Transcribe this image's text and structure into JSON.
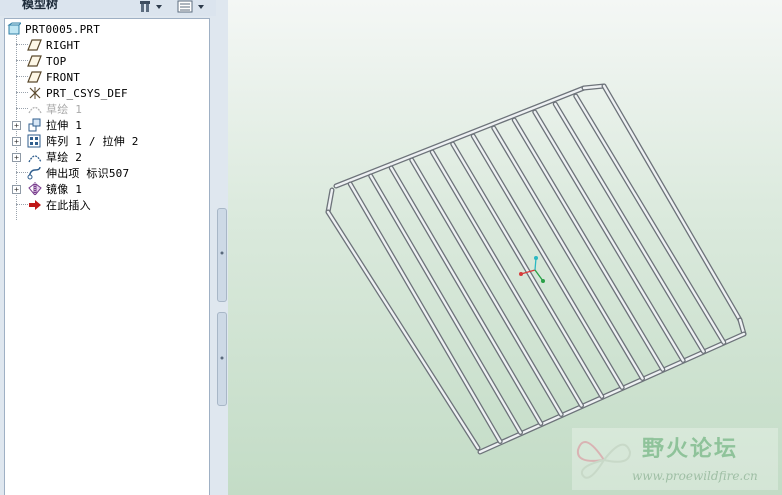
{
  "panel": {
    "title": "模型树",
    "settings_icon": "tree-settings-icon",
    "show_icon": "tree-show-icon"
  },
  "tree": {
    "root": "PRT0005.PRT",
    "items": [
      {
        "label": "RIGHT",
        "icon": "datum-plane-icon",
        "expandable": false,
        "suppressed": false
      },
      {
        "label": "TOP",
        "icon": "datum-plane-icon",
        "expandable": false,
        "suppressed": false
      },
      {
        "label": "FRONT",
        "icon": "datum-plane-icon",
        "expandable": false,
        "suppressed": false
      },
      {
        "label": "PRT_CSYS_DEF",
        "icon": "coordinate-system-icon",
        "expandable": false,
        "suppressed": false
      },
      {
        "label": "草绘 1",
        "icon": "sketch-icon",
        "expandable": false,
        "suppressed": true
      },
      {
        "label": "拉伸 1",
        "icon": "extrude-icon",
        "expandable": true,
        "suppressed": false
      },
      {
        "label": "阵列 1 / 拉伸 2",
        "icon": "pattern-icon",
        "expandable": true,
        "suppressed": false
      },
      {
        "label": "草绘 2",
        "icon": "sketch-icon",
        "expandable": true,
        "suppressed": false
      },
      {
        "label": "伸出项 标识507",
        "icon": "sweep-icon",
        "expandable": false,
        "suppressed": false
      },
      {
        "label": "镜像 1",
        "icon": "mirror-icon",
        "expandable": true,
        "suppressed": false
      },
      {
        "label": "在此插入",
        "icon": "insert-here-arrow-icon",
        "expandable": false,
        "suppressed": false
      }
    ]
  },
  "viewport": {
    "model": "wire-rack",
    "wire_color": "#9aa0a6",
    "background_top": "#f4f7f5",
    "background_bottom": "#c3dcc6"
  },
  "watermark": {
    "title": "野火论坛",
    "url": "www.proewildfire.cn"
  }
}
